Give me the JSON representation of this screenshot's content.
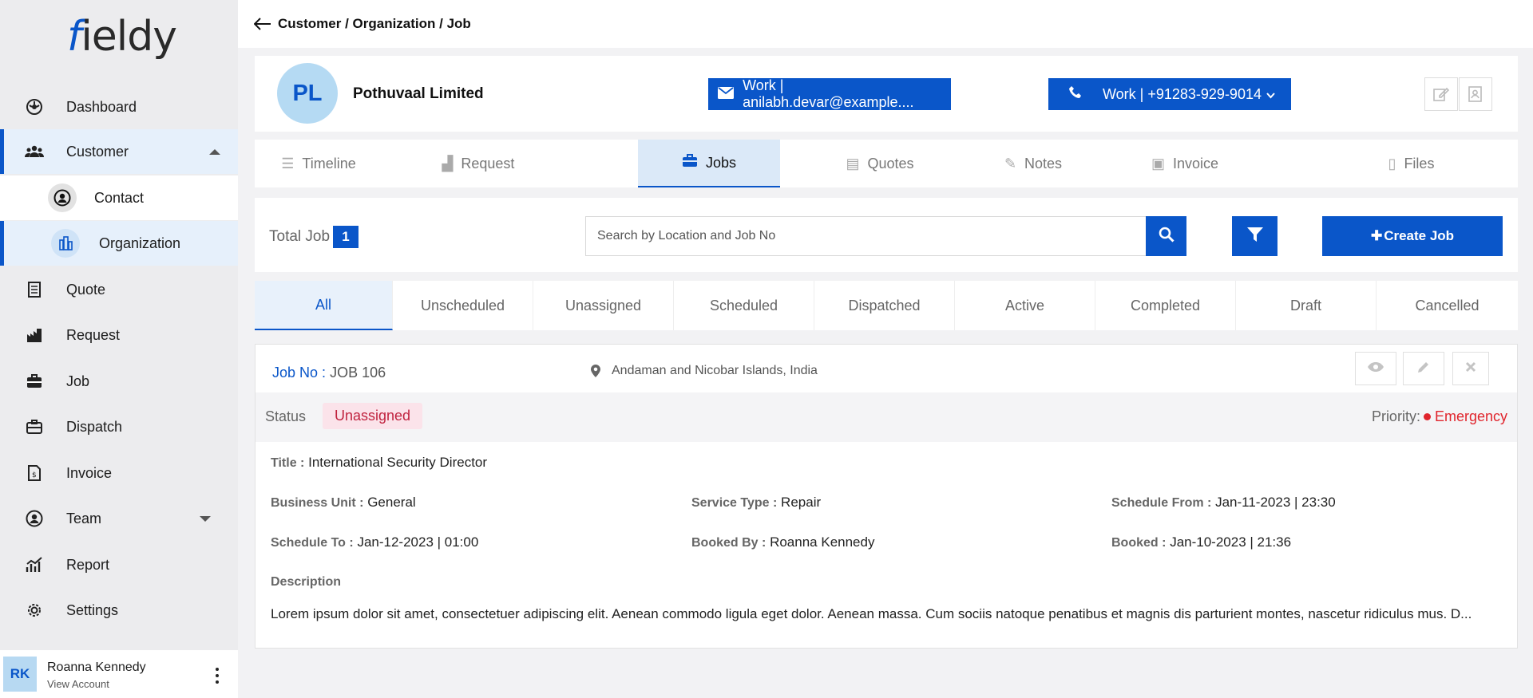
{
  "brand": {
    "logo_text": "ieldy",
    "logo_initial": "f"
  },
  "breadcrumb": "Customer / Organization / Job",
  "sidebar": {
    "items": [
      {
        "label": "Dashboard",
        "icon": "dashboard-icon"
      },
      {
        "label": "Customer",
        "icon": "customers-icon",
        "expanded": true
      },
      {
        "label": "Quote",
        "icon": "quote-icon"
      },
      {
        "label": "Request",
        "icon": "request-icon"
      },
      {
        "label": "Job",
        "icon": "job-icon"
      },
      {
        "label": "Dispatch",
        "icon": "dispatch-icon"
      },
      {
        "label": "Invoice",
        "icon": "invoice-icon"
      },
      {
        "label": "Team",
        "icon": "team-icon"
      },
      {
        "label": "Report",
        "icon": "report-icon"
      },
      {
        "label": "Settings",
        "icon": "settings-icon"
      }
    ],
    "sub_items": [
      {
        "label": "Contact",
        "icon": "contact-icon"
      },
      {
        "label": "Organization",
        "icon": "organization-icon"
      }
    ]
  },
  "account": {
    "initials": "RK",
    "name": "Roanna Kennedy",
    "link": "View Account"
  },
  "org": {
    "initials": "PL",
    "name": "Pothuvaal Limited",
    "email": "Work | anilabh.devar@example....",
    "phone": "Work | +91283-929-9014"
  },
  "tabs": [
    {
      "label": "Timeline",
      "icon": "timeline-icon"
    },
    {
      "label": "Request",
      "icon": "request-icon"
    },
    {
      "label": "Jobs",
      "icon": "briefcase-icon",
      "active": true
    },
    {
      "label": "Quotes",
      "icon": "quotes-icon"
    },
    {
      "label": "Notes",
      "icon": "notes-icon"
    },
    {
      "label": "Invoice",
      "icon": "invoice-icon"
    },
    {
      "label": "Files",
      "icon": "files-icon"
    }
  ],
  "toolbar": {
    "total_label": "Total Job",
    "total_count": "1",
    "search_placeholder": "Search by Location and Job No",
    "create_label": "Create Job"
  },
  "status_tabs": [
    "All",
    "Unscheduled",
    "Unassigned",
    "Scheduled",
    "Dispatched",
    "Active",
    "Completed",
    "Draft",
    "Cancelled"
  ],
  "job": {
    "no_label": "Job No :",
    "no_value": "JOB 106",
    "location": "Andaman and Nicobar Islands, India",
    "status_label": "Status",
    "status_value": "Unassigned",
    "priority_label": "Priority:",
    "priority_value": "Emergency",
    "title_label": "Title :",
    "title_value": "International Security Director",
    "business_unit_label": "Business Unit :",
    "business_unit_value": "General",
    "service_type_label": "Service Type :",
    "service_type_value": "Repair",
    "schedule_from_label": "Schedule From :",
    "schedule_from_value": "Jan-11-2023 | 23:30",
    "schedule_to_label": "Schedule To :",
    "schedule_to_value": "Jan-12-2023 | 01:00",
    "booked_by_label": "Booked By :",
    "booked_by_value": "Roanna Kennedy",
    "booked_label": "Booked :",
    "booked_value": "Jan-10-2023 | 21:36",
    "description_label": "Description",
    "description": "Lorem ipsum dolor sit amet, consectetuer adipiscing elit. Aenean commodo ligula eget dolor. Aenean massa. Cum sociis natoque penatibus et magnis dis parturient montes, nascetur ridiculus mus. D..."
  },
  "colors": {
    "primary": "#0a56c9",
    "danger": "#e0242c",
    "badge_bg": "#fbe3ea"
  }
}
